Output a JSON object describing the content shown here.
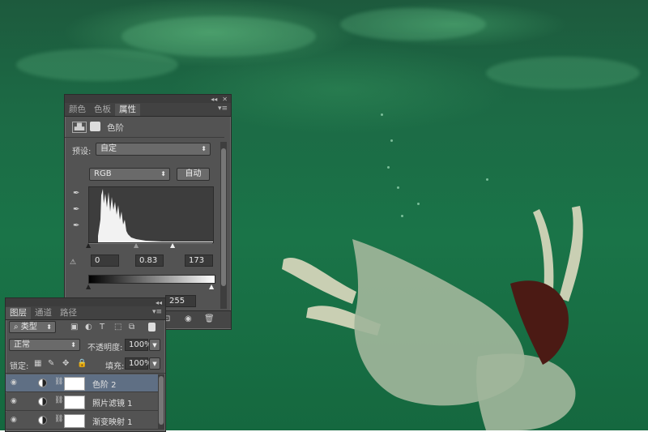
{
  "properties_panel": {
    "collapse_glyph": "◂◂",
    "close_glyph": "✕",
    "menu_glyph": "▾≡",
    "tabs": [
      {
        "label": "颜色",
        "active": false
      },
      {
        "label": "色板",
        "active": false
      },
      {
        "label": "属性",
        "active": true
      }
    ],
    "adjustment_title": "色阶",
    "preset_label": "预设:",
    "preset_value": "自定",
    "channel_value": "RGB",
    "auto_button": "自动",
    "input_black": "0",
    "input_gamma": "0.83",
    "input_white": "173",
    "output_white": "255"
  },
  "layers_panel": {
    "collapse_glyph": "◂◂",
    "menu_glyph": "▾≡",
    "tabs": [
      {
        "label": "图层",
        "active": true
      },
      {
        "label": "通道",
        "active": false
      },
      {
        "label": "路径",
        "active": false
      }
    ],
    "filter_label": "类型",
    "blend_mode": "正常",
    "opacity_label": "不透明度:",
    "opacity_value": "100%",
    "lock_label": "锁定:",
    "fill_label": "填充:",
    "fill_value": "100%",
    "layers": [
      {
        "name": "色阶 2",
        "selected": true
      },
      {
        "name": "照片滤镜 1",
        "selected": false
      },
      {
        "name": "渐变映射 1",
        "selected": false
      }
    ]
  },
  "colors": {
    "accent_selected_row": "#5f6f84",
    "panel_bg": "#535353",
    "water_green": "#1a7448"
  },
  "icons": [
    "eyedropper-black-icon",
    "eyedropper-gray-icon",
    "eyedropper-white-icon",
    "eye-icon",
    "trash-icon",
    "search-icon",
    "lock-icon",
    "link-icon"
  ]
}
